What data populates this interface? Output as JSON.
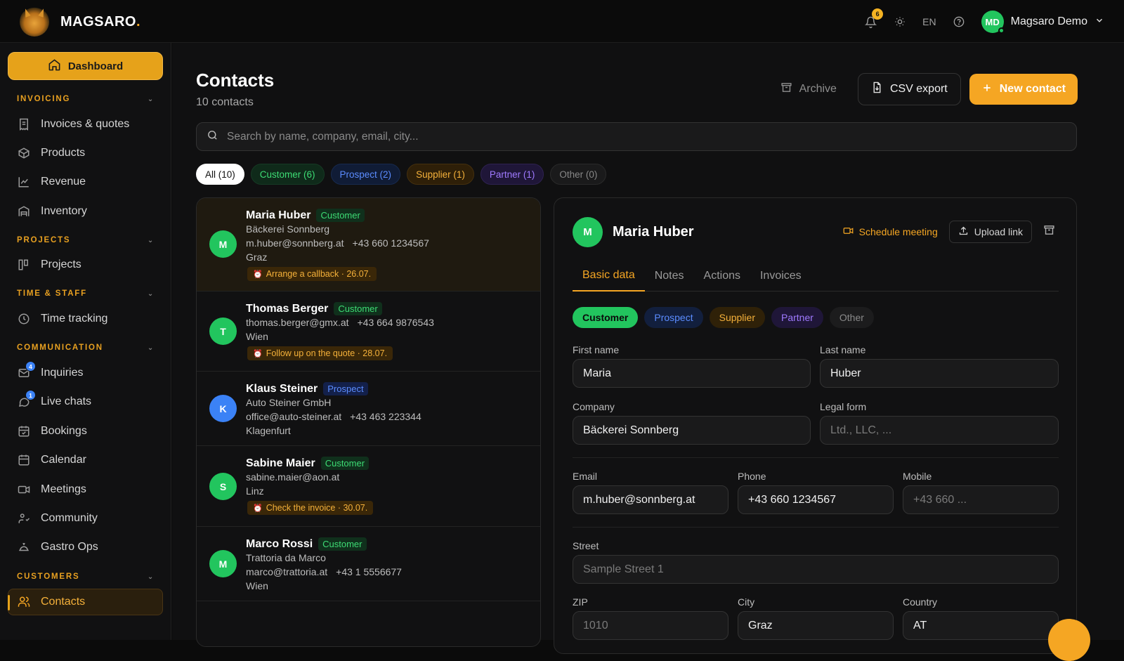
{
  "brand": {
    "name": "MAGSARO",
    "dot": "."
  },
  "topbar": {
    "notif_count": "6",
    "lang": "EN",
    "user_initials": "MD",
    "user_name": "Magsaro Demo"
  },
  "sidebar": {
    "dashboard": "Dashboard",
    "sections": {
      "invoicing": "INVOICING",
      "projects": "PROJECTS",
      "time": "TIME & STAFF",
      "communication": "COMMUNICATION",
      "customers": "CUSTOMERS"
    },
    "items": {
      "invoices": "Invoices & quotes",
      "products": "Products",
      "revenue": "Revenue",
      "inventory": "Inventory",
      "projects": "Projects",
      "time_tracking": "Time tracking",
      "inquiries": "Inquiries",
      "inquiries_badge": "4",
      "live_chats": "Live chats",
      "live_chats_badge": "1",
      "bookings": "Bookings",
      "calendar": "Calendar",
      "meetings": "Meetings",
      "community": "Community",
      "gastro": "Gastro Ops",
      "contacts": "Contacts"
    }
  },
  "page": {
    "title": "Contacts",
    "subtitle": "10 contacts",
    "archive": "Archive",
    "csv": "CSV export",
    "new": "New contact",
    "search_placeholder": "Search by name, company, email, city..."
  },
  "filters": {
    "all": "All (10)",
    "customer": "Customer (6)",
    "prospect": "Prospect (2)",
    "supplier": "Supplier (1)",
    "partner": "Partner (1)",
    "other": "Other (0)"
  },
  "contacts": [
    {
      "initial": "M",
      "name": "Maria Huber",
      "type": "Customer",
      "company": "Bäckerei Sonnberg",
      "email": "m.huber@sonnberg.at",
      "phone": "+43 660 1234567",
      "city": "Graz",
      "task": "Arrange a callback · 26.07."
    },
    {
      "initial": "T",
      "name": "Thomas Berger",
      "type": "Customer",
      "email": "thomas.berger@gmx.at",
      "phone": "+43 664 9876543",
      "city": "Wien",
      "task": "Follow up on the quote · 28.07."
    },
    {
      "initial": "K",
      "name": "Klaus Steiner",
      "type": "Prospect",
      "company": "Auto Steiner GmbH",
      "email": "office@auto-steiner.at",
      "phone": "+43 463 223344",
      "city": "Klagenfurt"
    },
    {
      "initial": "S",
      "name": "Sabine Maier",
      "type": "Customer",
      "email": "sabine.maier@aon.at",
      "city": "Linz",
      "task": "Check the invoice · 30.07."
    },
    {
      "initial": "M",
      "name": "Marco Rossi",
      "type": "Customer",
      "company": "Trattoria da Marco",
      "email": "marco@trattoria.at",
      "phone": "+43 1 5556677",
      "city": "Wien"
    }
  ],
  "detail": {
    "initial": "M",
    "name": "Maria Huber",
    "schedule": "Schedule meeting",
    "upload": "Upload link",
    "tabs": [
      "Basic data",
      "Notes",
      "Actions",
      "Invoices"
    ],
    "types": [
      "Customer",
      "Prospect",
      "Supplier",
      "Partner",
      "Other"
    ],
    "labels": {
      "first": "First name",
      "last": "Last name",
      "company": "Company",
      "legal": "Legal form",
      "email": "Email",
      "phone": "Phone",
      "mobile": "Mobile",
      "street": "Street",
      "zip": "ZIP",
      "city": "City",
      "country": "Country"
    },
    "values": {
      "first": "Maria",
      "last": "Huber",
      "company": "Bäckerei Sonnberg",
      "email": "m.huber@sonnberg.at",
      "phone": "+43 660 1234567",
      "zip": "1010",
      "city": "Graz",
      "country": "AT"
    },
    "placeholders": {
      "legal": "Ltd., LLC, ...",
      "mobile": "+43 660 ...",
      "street": "Sample Street 1"
    }
  },
  "colors": {
    "accent": "#f5a623",
    "customer": "#22c55e",
    "prospect": "#3b82f6",
    "partner": "#9f7aff"
  }
}
